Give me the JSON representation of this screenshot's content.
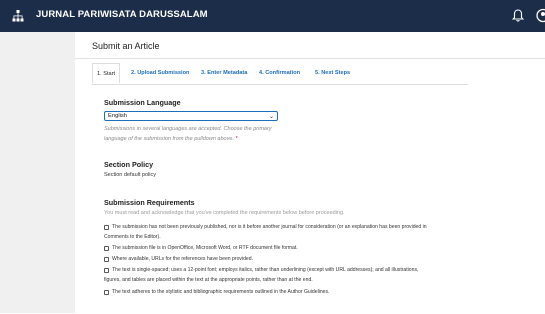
{
  "header": {
    "journal_title": "JURNAL PARIWISATA DARUSSALAM",
    "icons": [
      "sitemap-icon",
      "bell-icon",
      "user-icon"
    ]
  },
  "page": {
    "title": "Submit an Article"
  },
  "tabs": [
    {
      "label": "1. Start",
      "active": true
    },
    {
      "label": "2. Upload Submission",
      "active": false
    },
    {
      "label": "3. Enter Metadata",
      "active": false
    },
    {
      "label": "4. Confirmation",
      "active": false
    },
    {
      "label": "5. Next Steps",
      "active": false
    }
  ],
  "language": {
    "label": "Submission Language",
    "selected": "English",
    "help_line1": "Submissions in several languages are accepted. Choose the primary",
    "help_line2": "language of the submission from the pulldown above.",
    "required_mark": "*"
  },
  "section_policy": {
    "label": "Section Policy",
    "text": "Section default policy"
  },
  "requirements": {
    "label": "Submission Requirements",
    "intro": "You must read and acknowledge that you've completed the requirements below before proceeding.",
    "items": [
      {
        "line1": "The submission has not been previously published, nor is it before another journal for consideration (or an explanation has been provided in",
        "line2": "Comments to the Editor).",
        "checked": false
      },
      {
        "line1": "The submission file is in OpenOffice, Microsoft Word, or RTF document file format.",
        "checked": false
      },
      {
        "line1": "Where available, URLs for the references have been provided.",
        "checked": false
      },
      {
        "line1": "The text is single-spaced; uses a 12-point font; employs italics, rather than underlining (except with URL addresses); and all illustrations,",
        "line2": "figures, and tables are placed within the text at the appropriate points, rather than at the end.",
        "checked": false
      },
      {
        "line1": "The text adheres to the stylistic and bibliographic requirements outlined in the Author Guidelines.",
        "checked": false
      }
    ]
  },
  "colors": {
    "topbar": "#1c2d4a",
    "link": "#1d6fb8",
    "required": "#d0021b"
  }
}
